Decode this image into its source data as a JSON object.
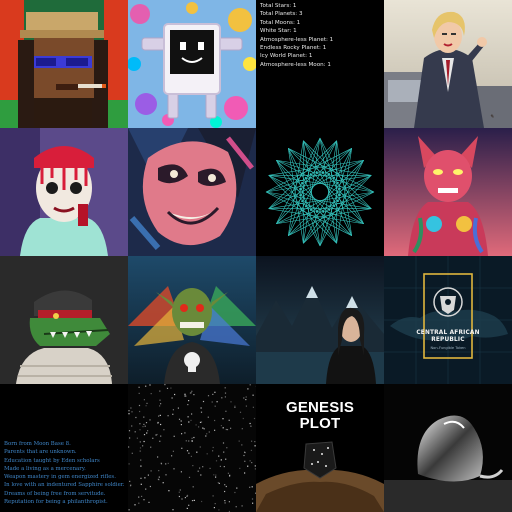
{
  "tiles": [
    {
      "name": "pixel-punk-tile"
    },
    {
      "name": "cube-robot-tile"
    },
    {
      "name": "galaxy-stats-tile",
      "stats": [
        "Total Stars: 1",
        "Total Planets: 3",
        "Total Moons: 1",
        "White Star: 1",
        "Atmosphere-less Planet: 1",
        "Endless Rocky Planet: 1",
        "Icy World Planet: 1",
        "Atmosphere-less Moon: 1"
      ]
    },
    {
      "name": "businesswoman-illustration-tile"
    },
    {
      "name": "dripping-face-portrait-tile"
    },
    {
      "name": "abstract-painted-face-tile"
    },
    {
      "name": "teal-string-art-tile"
    },
    {
      "name": "tattooed-cat-creature-tile"
    },
    {
      "name": "crocodile-character-tile"
    },
    {
      "name": "winged-goblin-tile"
    },
    {
      "name": "woman-mountain-landscape-tile"
    },
    {
      "name": "central-african-republic-badge-tile",
      "badge": {
        "line1": "CENTRAL AFRICAN",
        "line2": "REPUBLIC",
        "line3": "Non-Fungible Token"
      }
    },
    {
      "name": "character-backstory-tile",
      "story": [
        "Born from Moon Base 8.",
        "Parents that are unknown.",
        "Education taught by Eden scholars",
        "Made a living as a mercenary.",
        "Weapon mastery in gem energized rifles.",
        "In love with an indentured Sapphire soldier.",
        "Dreams of being free from servitude.",
        "Reputation for being a philanthropist."
      ]
    },
    {
      "name": "dark-city-lights-tile"
    },
    {
      "name": "genesis-plot-tile",
      "title_line1": "GENESIS",
      "title_line2": "PLOT"
    },
    {
      "name": "chrome-sculpture-tile"
    }
  ],
  "colors": {
    "background": "#000000",
    "stats_text": "#e8e8e8",
    "story_text": "#3f86c8",
    "teal_lines": "#3ad6cf",
    "badge_frame": "#e0b63c"
  }
}
